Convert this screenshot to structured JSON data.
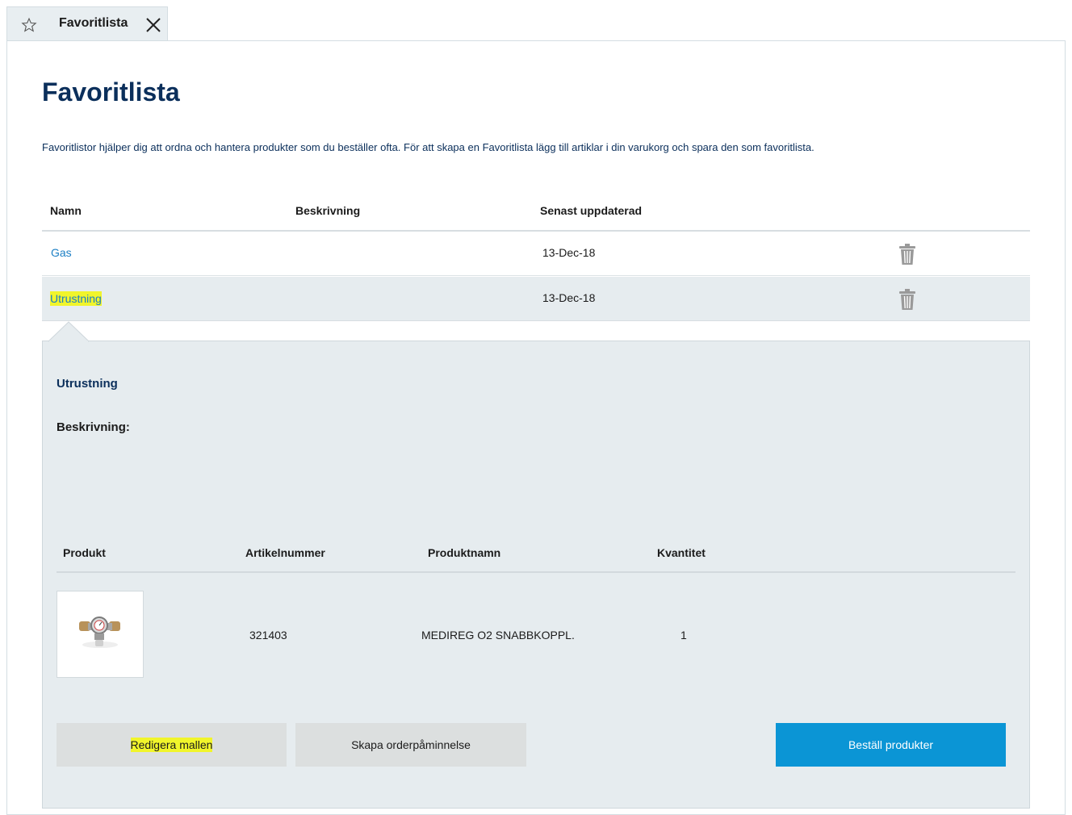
{
  "tab": {
    "title": "Favoritlista",
    "icon": "star-icon",
    "close_icon": "close-icon"
  },
  "page": {
    "title": "Favoritlista",
    "intro": "Favoritlistor hjälper dig att ordna och hantera produkter som du beställer ofta. För att skapa en Favoritlista lägg till artiklar i din varukorg och spara den som favoritlista."
  },
  "table": {
    "headers": [
      "Namn",
      "Beskrivning",
      "Senast uppdaterad"
    ],
    "rows": [
      {
        "name": "Gas",
        "description": "",
        "updated": "13-Dec-18"
      },
      {
        "name": "Utrustning",
        "description": "",
        "updated": "13-Dec-18"
      }
    ]
  },
  "detail": {
    "title": "Utrustning",
    "description_label": "Beskrivning:",
    "headers": [
      "Produkt",
      "Artikelnummer",
      "Produktnamn",
      "Kvantitet"
    ],
    "items": [
      {
        "article_number": "321403",
        "product_name": "MEDIREG O2 SNABBKOPPL.",
        "quantity": "1"
      }
    ],
    "buttons": {
      "edit": "Redigera mallen",
      "reminder": "Skapa orderpåminnelse",
      "order": "Beställ produkter"
    }
  },
  "colors": {
    "title": "#0b2f5b",
    "link": "#1c7fc4",
    "highlight": "#f1f52b",
    "primary_button": "#0b95d5",
    "secondary_button": "#dcdfdf",
    "detail_background": "#e6ecef"
  }
}
